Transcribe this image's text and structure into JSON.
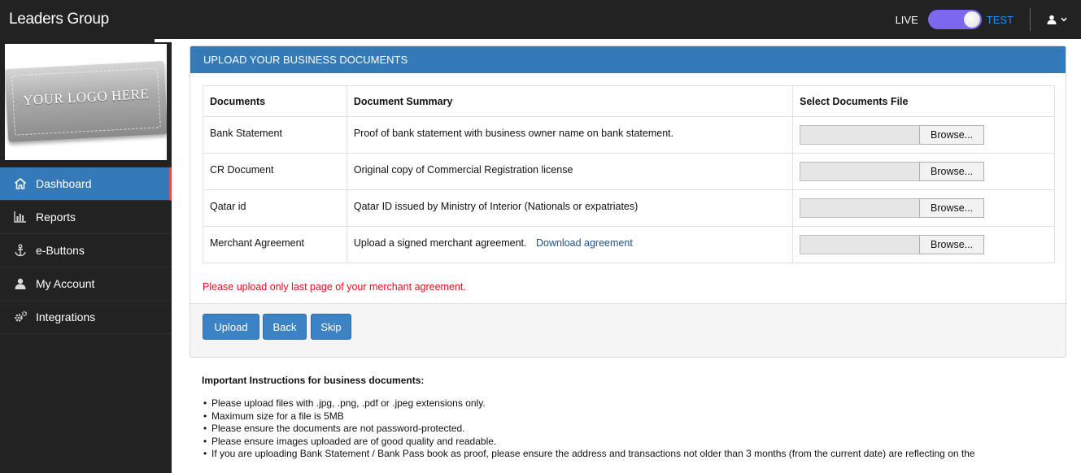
{
  "header": {
    "brand": "Leaders Group",
    "env_live": "LIVE",
    "env_test": "TEST",
    "colors": {
      "bar": "#222222",
      "toggle": "#7b68ee",
      "test": "#2a8df4"
    }
  },
  "sidebar": {
    "logo_text": "YOUR LOGO HERE",
    "items": [
      {
        "label": "Dashboard",
        "icon": "home-icon",
        "active": true
      },
      {
        "label": "Reports",
        "icon": "bar-chart-icon"
      },
      {
        "label": "e-Buttons",
        "icon": "anchor-icon"
      },
      {
        "label": "My Account",
        "icon": "user-icon"
      },
      {
        "label": "Integrations",
        "icon": "cogs-icon"
      }
    ],
    "active_color": "#357ab8"
  },
  "panel": {
    "title": "UPLOAD YOUR BUSINESS DOCUMENTS",
    "columns": [
      "Documents",
      "Document Summary",
      "Select Documents File"
    ],
    "rows": [
      {
        "document": "Bank Statement",
        "summary": "Proof of bank statement with business owner name on bank statement.",
        "browse": "Browse..."
      },
      {
        "document": "CR Document",
        "summary": "Original copy of Commercial Registration license",
        "browse": "Browse..."
      },
      {
        "document": "Qatar id",
        "summary": "Qatar ID issued by Ministry of Interior (Nationals or expatriates)",
        "browse": "Browse..."
      },
      {
        "document": "Merchant Agreement",
        "summary": "Upload a signed merchant agreement.",
        "link": "Download agreement",
        "browse": "Browse..."
      }
    ],
    "warning": "Please upload only last page of your merchant agreement.",
    "buttons": {
      "upload": "Upload",
      "back": "Back",
      "skip": "Skip"
    }
  },
  "instructions": {
    "title": "Important Instructions for business documents:",
    "items": [
      "Please upload files with .jpg, .png, .pdf or .jpeg extensions only.",
      "Maximum size for a file is 5MB",
      "Please ensure the documents are not password-protected.",
      "Please ensure images uploaded are of good quality and readable.",
      "If you are uploading Bank Statement / Bank Pass book as proof, please ensure the address and transactions not older than 3 months (from the current date) are reflecting on the"
    ]
  }
}
